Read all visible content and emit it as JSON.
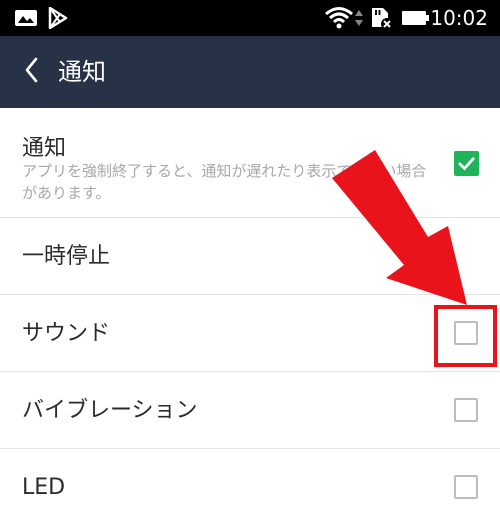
{
  "status_bar": {
    "time": "10:02",
    "icons": [
      "image-icon",
      "play-store-icon",
      "wifi-icon",
      "sd-card-icon",
      "battery-icon"
    ]
  },
  "app_bar": {
    "title": "通知",
    "back_icon": "chevron-left-icon"
  },
  "settings": [
    {
      "title": "通知",
      "description": "アプリを強制終了すると、通知が遅れたり表示できない場合があります。",
      "checked": true
    },
    {
      "title": "一時停止"
    },
    {
      "title": "サウンド",
      "checked": false,
      "highlighted": true
    },
    {
      "title": "バイブレーション",
      "checked": false
    },
    {
      "title": "LED",
      "checked": false
    }
  ],
  "colors": {
    "status_bar": "#000000",
    "app_bar": "#283247",
    "accent_green": "#1eb55a",
    "annotation_red": "#e8131b"
  }
}
